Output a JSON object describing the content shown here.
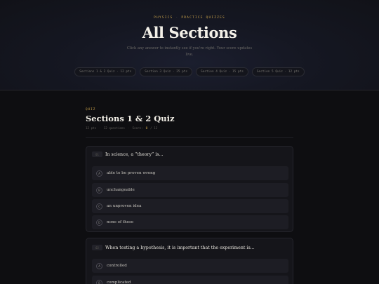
{
  "hero": {
    "eyebrow_left": "PHYSICS",
    "eyebrow_right": "PRACTICE QUIZZES",
    "title": "All Sections",
    "subtitle": "Click any answer to instantly see if you're right. Your score updates live.",
    "pills": [
      "Sections 1 & 2 Quiz · 12 pts",
      "Section 3 Quiz · 25 pts",
      "Section 4 Quiz · 15 pts",
      "Section 5 Quiz · 12 pts"
    ]
  },
  "quiz": {
    "tag": "QUIZ",
    "title": "Sections 1 & 2 Quiz",
    "points": "12 pts",
    "questions_count": "12 questions",
    "score_label": "Score:",
    "score_value": "0",
    "score_total": "/ 12"
  },
  "questions": [
    {
      "number": "01",
      "text": "In science, a “theory” is...",
      "options": [
        {
          "letter": "A",
          "text": "able to be proven wrong"
        },
        {
          "letter": "B",
          "text": "unchangeable"
        },
        {
          "letter": "C",
          "text": "an unproven idea"
        },
        {
          "letter": "D",
          "text": "none of these"
        }
      ]
    },
    {
      "number": "02",
      "text": "When testing a hypothesis, it is important that the experiment is...",
      "options": [
        {
          "letter": "A",
          "text": "controlled"
        },
        {
          "letter": "B",
          "text": "complicated"
        }
      ]
    }
  ],
  "colors": {
    "accent": "#c9a24a",
    "background": "#0e0e11",
    "card": "#15151a",
    "option": "#1d1d24"
  }
}
